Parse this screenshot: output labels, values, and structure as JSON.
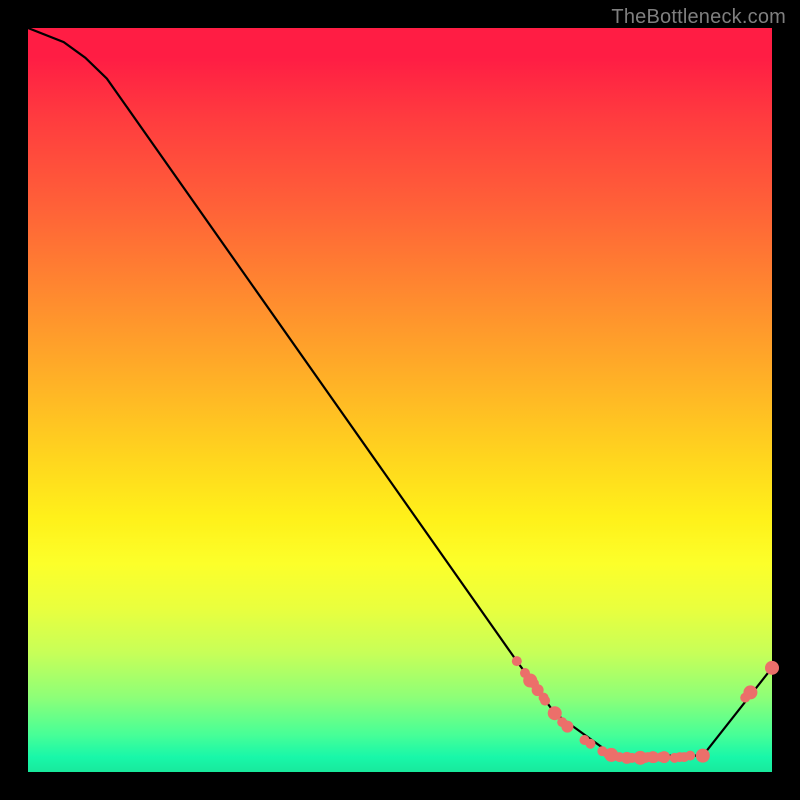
{
  "watermark": "TheBottleneck.com",
  "chart_data": {
    "type": "line",
    "title": "",
    "xlabel": "",
    "ylabel": "",
    "xlim": [
      0,
      100
    ],
    "ylim": [
      0,
      100
    ],
    "series": [
      {
        "name": "curve",
        "x": [
          0,
          4.8,
          7.7,
          10.6,
          65.7,
          70.8,
          78.7,
          90.7,
          100
        ],
        "y": [
          100,
          98.1,
          96.0,
          93.2,
          14.9,
          7.9,
          2.2,
          2.2,
          14.0
        ]
      }
    ],
    "markers": [
      {
        "name": "points",
        "x": [
          65.7,
          66.8,
          67.5,
          68.0,
          68.5,
          69.3,
          69.5,
          70.8,
          71.8,
          72.5,
          74.8,
          75.6,
          77.2,
          78.4,
          78.0,
          79.5,
          80.5,
          81.2,
          82.3,
          83.0,
          83.3,
          84.0,
          84.2,
          85.1,
          85.5,
          86.9,
          87.6,
          88.2,
          89.0,
          90.5,
          90.7,
          96.4,
          97.1,
          100
        ],
        "y": [
          14.9,
          13.3,
          12.3,
          11.9,
          11.0,
          10.0,
          9.6,
          7.9,
          6.7,
          6.1,
          4.3,
          3.8,
          2.8,
          2.3,
          2.4,
          2.0,
          1.9,
          1.9,
          1.9,
          1.9,
          2.0,
          2.0,
          1.9,
          2.0,
          2.0,
          1.9,
          2.0,
          2.0,
          2.2,
          2.0,
          2.2,
          10.0,
          10.7,
          14.0
        ],
        "radius": [
          5,
          5,
          7,
          5,
          6,
          5,
          5,
          7,
          5,
          6,
          5,
          5,
          5,
          7,
          5,
          5,
          6,
          5,
          7,
          5,
          5,
          6,
          5,
          5,
          6,
          5,
          5,
          5,
          5,
          5,
          7,
          5,
          7,
          7
        ],
        "color": "#ec6f6a"
      }
    ],
    "colors": {
      "curve": "#000000",
      "marker": "#ec6f6a"
    }
  }
}
